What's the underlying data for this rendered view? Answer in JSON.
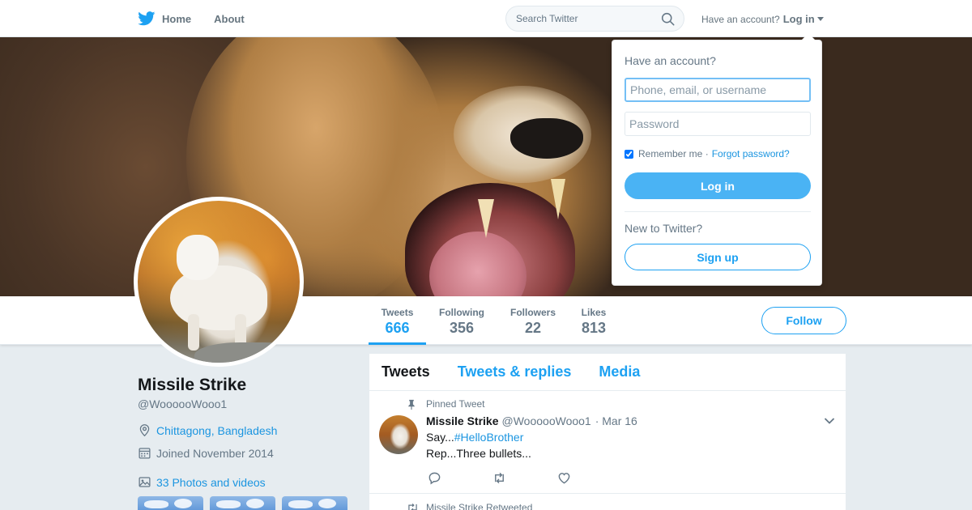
{
  "nav": {
    "home_label": "Home",
    "about_label": "About",
    "search_placeholder": "Search Twitter",
    "account_prompt": "Have an account?",
    "login_label": "Log in"
  },
  "profile": {
    "name": "Missile Strike",
    "handle": "@WoooooWooo1",
    "location": "Chittagong, Bangladesh",
    "joined": "Joined November 2014",
    "photos_label": "33 Photos and videos"
  },
  "stats": [
    {
      "label": "Tweets",
      "value": "666"
    },
    {
      "label": "Following",
      "value": "356"
    },
    {
      "label": "Followers",
      "value": "22"
    },
    {
      "label": "Likes",
      "value": "813"
    }
  ],
  "follow_label": "Follow",
  "timeline": {
    "tabs": [
      "Tweets",
      "Tweets & replies",
      "Media"
    ],
    "pinned_label": "Pinned Tweet",
    "tweet": {
      "name": "Missile Strike",
      "handle": "@WoooooWooo1",
      "date": "· Mar 16",
      "text_prefix": "Say...",
      "hashtag": "#HelloBrother",
      "line2": "Rep...Three bullets..."
    },
    "retweeted_label": "Missile Strike Retweeted"
  },
  "login_popup": {
    "title": "Have an account?",
    "username_placeholder": "Phone, email, or username",
    "password_placeholder": "Password",
    "remember_label": "Remember me ·",
    "forgot_label": "Forgot password?",
    "login_button": "Log in",
    "new_prompt": "New to Twitter?",
    "signup_button": "Sign up"
  },
  "colors": {
    "accent": "#1da1f2",
    "link": "#1b95e0",
    "login_button": "#4ab3f4",
    "page_bg": "#e6ecf0"
  }
}
